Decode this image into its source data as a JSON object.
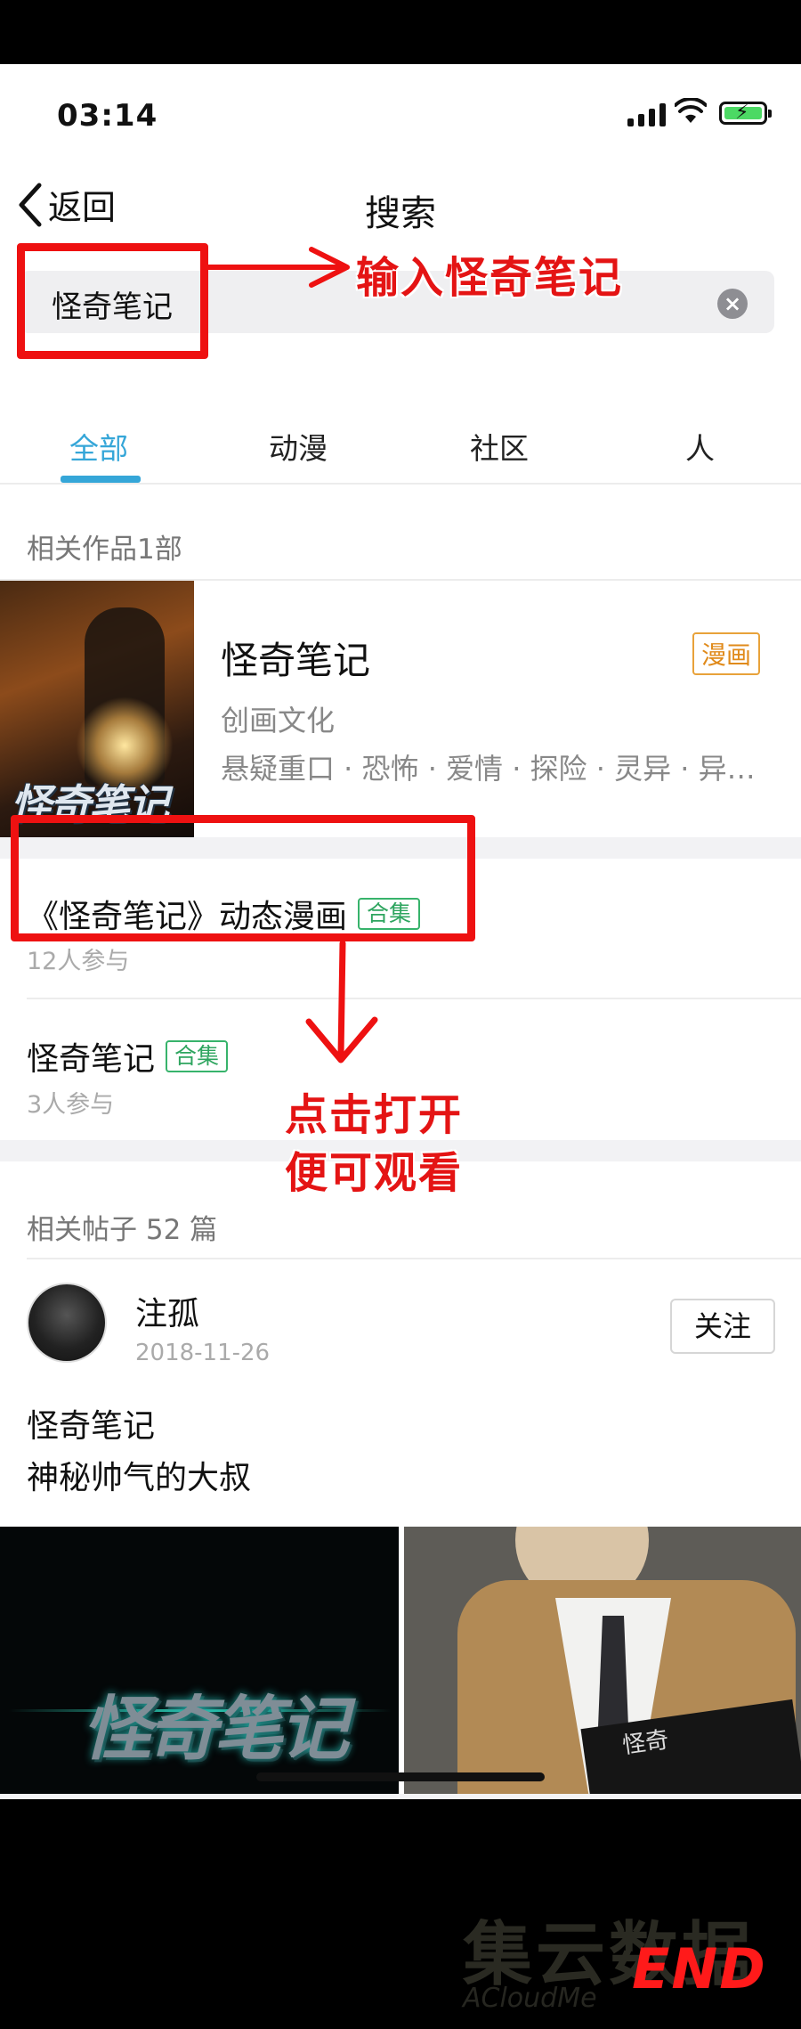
{
  "status_bar": {
    "time": "03:14"
  },
  "nav": {
    "back_label": "返回",
    "title": "搜索"
  },
  "search": {
    "query": "怪奇笔记"
  },
  "tabs": [
    "全部",
    "动漫",
    "社区",
    "人"
  ],
  "works": {
    "header": "相关作品1部",
    "item": {
      "title": "怪奇笔记",
      "badge": "漫画",
      "author": "创画文化",
      "tags": "悬疑重口 · 恐怖 · 爱情 · 探险 · 灵异 · 异…",
      "cover_logo": "怪奇笔记"
    }
  },
  "topics": [
    {
      "title": "《怪奇笔记》动态漫画",
      "badge": "合集",
      "participants": "12人参与"
    },
    {
      "title": "怪奇笔记",
      "badge": "合集",
      "participants": "3人参与"
    }
  ],
  "posts": {
    "header": "相关帖子 52 篇",
    "item": {
      "author": "注孤",
      "date": "2018-11-26",
      "follow_label": "关注",
      "lines": [
        "怪奇笔记",
        "神秘帅气的大叔"
      ],
      "image_logo": "怪奇笔记",
      "book_text": "怪奇"
    }
  },
  "annotations": {
    "input_hint": "输入怪奇笔记",
    "click_hint_line1": "点击打开",
    "click_hint_line2": "便可观看",
    "end": "END",
    "watermark": "集云数据",
    "watermark_sub": "ACloudMe",
    "accent": "#ee1111"
  },
  "colors": {
    "tab_active": "#35a6d8",
    "badge_comic": "#e8a23a",
    "badge_collection": "#37b36b"
  }
}
